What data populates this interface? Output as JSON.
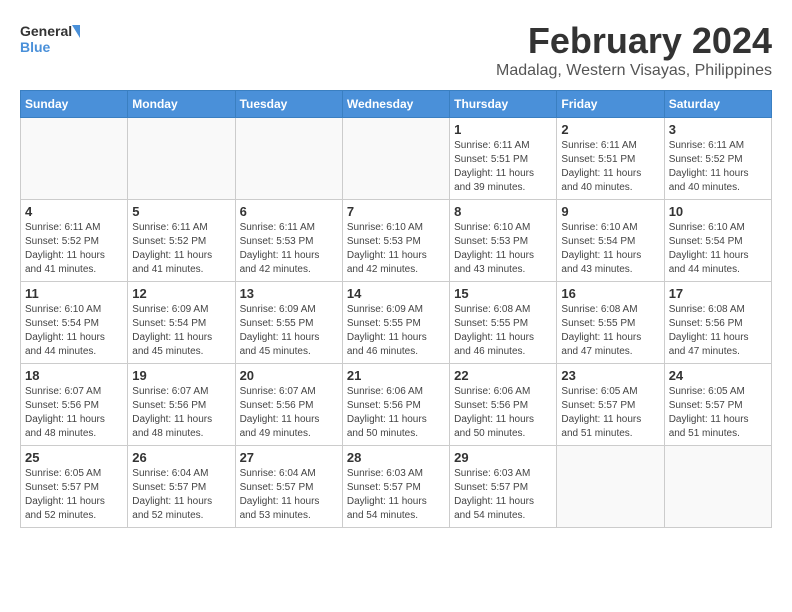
{
  "logo": {
    "line1": "General",
    "line2": "Blue"
  },
  "title": "February 2024",
  "subtitle": "Madalag, Western Visayas, Philippines",
  "days_of_week": [
    "Sunday",
    "Monday",
    "Tuesday",
    "Wednesday",
    "Thursday",
    "Friday",
    "Saturday"
  ],
  "weeks": [
    [
      {
        "num": "",
        "info": ""
      },
      {
        "num": "",
        "info": ""
      },
      {
        "num": "",
        "info": ""
      },
      {
        "num": "",
        "info": ""
      },
      {
        "num": "1",
        "info": "Sunrise: 6:11 AM\nSunset: 5:51 PM\nDaylight: 11 hours\nand 39 minutes."
      },
      {
        "num": "2",
        "info": "Sunrise: 6:11 AM\nSunset: 5:51 PM\nDaylight: 11 hours\nand 40 minutes."
      },
      {
        "num": "3",
        "info": "Sunrise: 6:11 AM\nSunset: 5:52 PM\nDaylight: 11 hours\nand 40 minutes."
      }
    ],
    [
      {
        "num": "4",
        "info": "Sunrise: 6:11 AM\nSunset: 5:52 PM\nDaylight: 11 hours\nand 41 minutes."
      },
      {
        "num": "5",
        "info": "Sunrise: 6:11 AM\nSunset: 5:52 PM\nDaylight: 11 hours\nand 41 minutes."
      },
      {
        "num": "6",
        "info": "Sunrise: 6:11 AM\nSunset: 5:53 PM\nDaylight: 11 hours\nand 42 minutes."
      },
      {
        "num": "7",
        "info": "Sunrise: 6:10 AM\nSunset: 5:53 PM\nDaylight: 11 hours\nand 42 minutes."
      },
      {
        "num": "8",
        "info": "Sunrise: 6:10 AM\nSunset: 5:53 PM\nDaylight: 11 hours\nand 43 minutes."
      },
      {
        "num": "9",
        "info": "Sunrise: 6:10 AM\nSunset: 5:54 PM\nDaylight: 11 hours\nand 43 minutes."
      },
      {
        "num": "10",
        "info": "Sunrise: 6:10 AM\nSunset: 5:54 PM\nDaylight: 11 hours\nand 44 minutes."
      }
    ],
    [
      {
        "num": "11",
        "info": "Sunrise: 6:10 AM\nSunset: 5:54 PM\nDaylight: 11 hours\nand 44 minutes."
      },
      {
        "num": "12",
        "info": "Sunrise: 6:09 AM\nSunset: 5:54 PM\nDaylight: 11 hours\nand 45 minutes."
      },
      {
        "num": "13",
        "info": "Sunrise: 6:09 AM\nSunset: 5:55 PM\nDaylight: 11 hours\nand 45 minutes."
      },
      {
        "num": "14",
        "info": "Sunrise: 6:09 AM\nSunset: 5:55 PM\nDaylight: 11 hours\nand 46 minutes."
      },
      {
        "num": "15",
        "info": "Sunrise: 6:08 AM\nSunset: 5:55 PM\nDaylight: 11 hours\nand 46 minutes."
      },
      {
        "num": "16",
        "info": "Sunrise: 6:08 AM\nSunset: 5:55 PM\nDaylight: 11 hours\nand 47 minutes."
      },
      {
        "num": "17",
        "info": "Sunrise: 6:08 AM\nSunset: 5:56 PM\nDaylight: 11 hours\nand 47 minutes."
      }
    ],
    [
      {
        "num": "18",
        "info": "Sunrise: 6:07 AM\nSunset: 5:56 PM\nDaylight: 11 hours\nand 48 minutes."
      },
      {
        "num": "19",
        "info": "Sunrise: 6:07 AM\nSunset: 5:56 PM\nDaylight: 11 hours\nand 48 minutes."
      },
      {
        "num": "20",
        "info": "Sunrise: 6:07 AM\nSunset: 5:56 PM\nDaylight: 11 hours\nand 49 minutes."
      },
      {
        "num": "21",
        "info": "Sunrise: 6:06 AM\nSunset: 5:56 PM\nDaylight: 11 hours\nand 50 minutes."
      },
      {
        "num": "22",
        "info": "Sunrise: 6:06 AM\nSunset: 5:56 PM\nDaylight: 11 hours\nand 50 minutes."
      },
      {
        "num": "23",
        "info": "Sunrise: 6:05 AM\nSunset: 5:57 PM\nDaylight: 11 hours\nand 51 minutes."
      },
      {
        "num": "24",
        "info": "Sunrise: 6:05 AM\nSunset: 5:57 PM\nDaylight: 11 hours\nand 51 minutes."
      }
    ],
    [
      {
        "num": "25",
        "info": "Sunrise: 6:05 AM\nSunset: 5:57 PM\nDaylight: 11 hours\nand 52 minutes."
      },
      {
        "num": "26",
        "info": "Sunrise: 6:04 AM\nSunset: 5:57 PM\nDaylight: 11 hours\nand 52 minutes."
      },
      {
        "num": "27",
        "info": "Sunrise: 6:04 AM\nSunset: 5:57 PM\nDaylight: 11 hours\nand 53 minutes."
      },
      {
        "num": "28",
        "info": "Sunrise: 6:03 AM\nSunset: 5:57 PM\nDaylight: 11 hours\nand 54 minutes."
      },
      {
        "num": "29",
        "info": "Sunrise: 6:03 AM\nSunset: 5:57 PM\nDaylight: 11 hours\nand 54 minutes."
      },
      {
        "num": "",
        "info": ""
      },
      {
        "num": "",
        "info": ""
      }
    ]
  ]
}
